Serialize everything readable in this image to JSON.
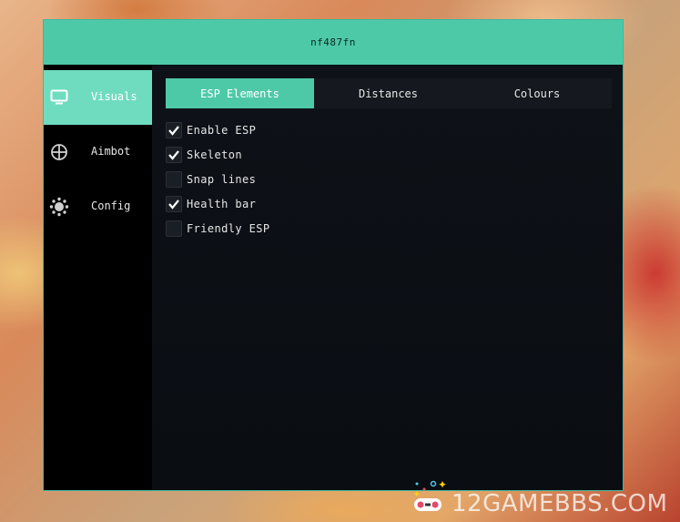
{
  "window": {
    "title": "nf487fn"
  },
  "sidebar": {
    "items": [
      {
        "label": "Visuals",
        "icon": "monitor-icon",
        "active": true
      },
      {
        "label": "Aimbot",
        "icon": "crosshair-icon",
        "active": false
      },
      {
        "label": "Config",
        "icon": "gear-icon",
        "active": false
      }
    ]
  },
  "tabs": [
    {
      "label": "ESP Elements",
      "active": true
    },
    {
      "label": "Distances",
      "active": false
    },
    {
      "label": "Colours",
      "active": false
    }
  ],
  "options": [
    {
      "label": "Enable ESP",
      "checked": true
    },
    {
      "label": "Skeleton",
      "checked": true
    },
    {
      "label": "Snap lines",
      "checked": false
    },
    {
      "label": "Health bar",
      "checked": true
    },
    {
      "label": "Friendly ESP",
      "checked": false
    }
  ],
  "watermark": {
    "text": "12GAMEBBS.COM",
    "icon": "gamepad-icon"
  },
  "colors": {
    "accent": "#4ec9a8",
    "sidebar_active": "#6fdcc0",
    "panel": "#0c0f14",
    "sidebar": "#000000"
  }
}
